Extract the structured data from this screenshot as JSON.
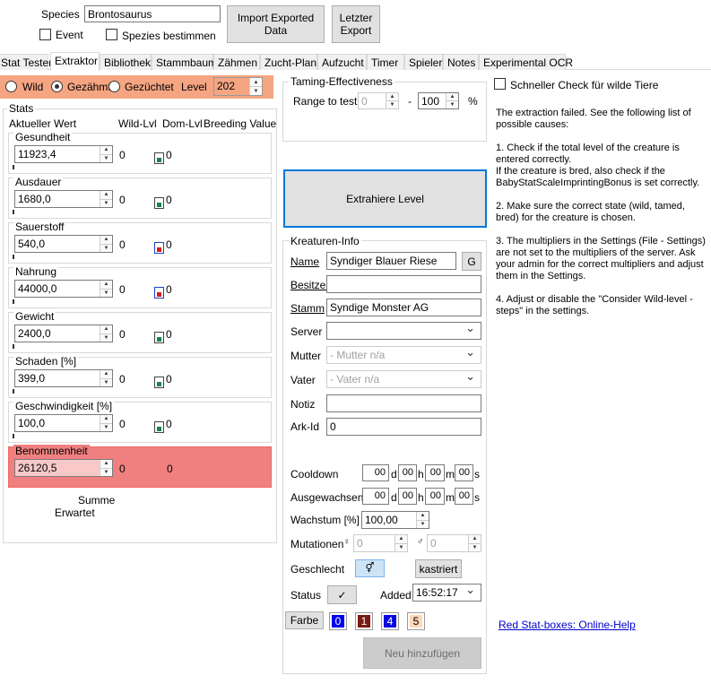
{
  "header": {
    "species_label": "Species",
    "species_value": "Brontosaurus",
    "event_label": "Event",
    "determine_species_label": "Spezies bestimmen",
    "import_button": "Import Exported Data",
    "last_export_button": "Letzter Export"
  },
  "tabs": [
    "Stat Tester",
    "Extraktor",
    "Bibliothek",
    "Stammbaum",
    "Zähmen",
    "Zucht-Plan",
    "Aufzucht",
    "Timer",
    "Spieler",
    "Notes",
    "Experimental OCR"
  ],
  "active_tab": "Extraktor",
  "state": {
    "wild_label": "Wild",
    "tamed_label": "Gezähmt",
    "bred_label": "Gezüchtet",
    "selected": "Gezähmt",
    "level_label": "Level",
    "level_value": "202",
    "highlight_color": "#f5a582"
  },
  "stats": {
    "title": "Stats",
    "col_current": "Aktueller Wert",
    "col_wild": "Wild-Lvl",
    "col_dom": "Dom-Lvl",
    "col_breeding": "Breeding Value",
    "items": [
      {
        "name": "Gesundheit",
        "value": "11923,4",
        "wild": "0",
        "dom": "0",
        "lock": "green"
      },
      {
        "name": "Ausdauer",
        "value": "1680,0",
        "wild": "0",
        "dom": "0",
        "lock": "green"
      },
      {
        "name": "Sauerstoff",
        "value": "540,0",
        "wild": "0",
        "dom": "0",
        "lock": "red"
      },
      {
        "name": "Nahrung",
        "value": "44000,0",
        "wild": "0",
        "dom": "0",
        "lock": "red"
      },
      {
        "name": "Gewicht",
        "value": "2400,0",
        "wild": "0",
        "dom": "0",
        "lock": "green"
      },
      {
        "name": "Schaden [%]",
        "value": "399,0",
        "wild": "0",
        "dom": "0",
        "lock": "green"
      },
      {
        "name": "Geschwindigkeit [%]",
        "value": "100,0",
        "wild": "0",
        "dom": "0",
        "lock": "green"
      },
      {
        "name": "Benommenheit",
        "value": "26120,5",
        "wild": "0",
        "dom": "0",
        "lock": "none"
      }
    ],
    "sum_label": "Summe",
    "expected_label": "Erwartet",
    "error_color": "#f08080"
  },
  "taming": {
    "title": "Taming-Effectiveness",
    "range_label": "Range to test",
    "range_min": "0",
    "range_sep": "-",
    "range_max": "100",
    "unit": "%"
  },
  "extract_button": "Extrahiere Level",
  "creature_info": {
    "title": "Kreaturen-Info",
    "name_label": "Name",
    "name_value": "Syndiger Blauer Riese",
    "name_gen_button": "G",
    "owner_label": "Besitzer",
    "owner_value": "",
    "tribe_label": "Stamm",
    "tribe_value": "Syndige Monster AG",
    "server_label": "Server",
    "server_value": "",
    "mother_label": "Mutter",
    "mother_value": "- Mutter n/a",
    "father_label": "Vater",
    "father_value": "- Vater n/a",
    "note_label": "Notiz",
    "note_value": "",
    "arkid_label": "Ark-Id",
    "arkid_value": "0",
    "cooldown_label": "Cooldown",
    "grown_label": "Ausgewachsen",
    "time_d": "00",
    "time_h": "00",
    "time_m": "00",
    "time_s": "00",
    "unit_d": "d",
    "unit_h": "h",
    "unit_m": "m",
    "unit_s": "s",
    "growth_label": "Wachstum [%]",
    "growth_value": "100,00",
    "mutations_label": "Mutationen",
    "mut_mother": "0",
    "mut_father": "0",
    "sex_label": "Geschlecht",
    "neutered_button": "kastriert",
    "status_label": "Status",
    "status_value": "✓",
    "added_label": "Added",
    "added_value": "16:52:17",
    "color_button": "Farbe",
    "colors": [
      {
        "value": "0",
        "bg": "#0000ee",
        "fg": "#ffffff"
      },
      {
        "value": "1",
        "bg": "#7a1a12",
        "fg": "#ffffff"
      },
      {
        "value": "4",
        "bg": "#0a0ae0",
        "fg": "#ffffff"
      },
      {
        "value": "5",
        "bg": "#f9d8b8",
        "fg": "#000000"
      }
    ],
    "add_button": "Neu hinzufügen"
  },
  "quick_check_label": "Schneller Check für wilde Tiere",
  "help": [
    "The extraction failed. See the following list of possible causes:",
    "1. Check if the total level of the creature is entered correctly.\nIf the creature is bred, also check if the BabyStatScaleImprintingBonus is set correctly.",
    "2. Make sure the correct state (wild, tamed, bred) for the creature is chosen.",
    "3. The multipliers in the Settings (File - Settings) are not set to the multipliers of the server. Ask your admin for the correct multipliers and adjust them in the Settings.",
    "4. Adjust or disable the \"Consider Wild-level -steps\" in the settings."
  ],
  "help_link": "Red Stat-boxes: Online-Help"
}
